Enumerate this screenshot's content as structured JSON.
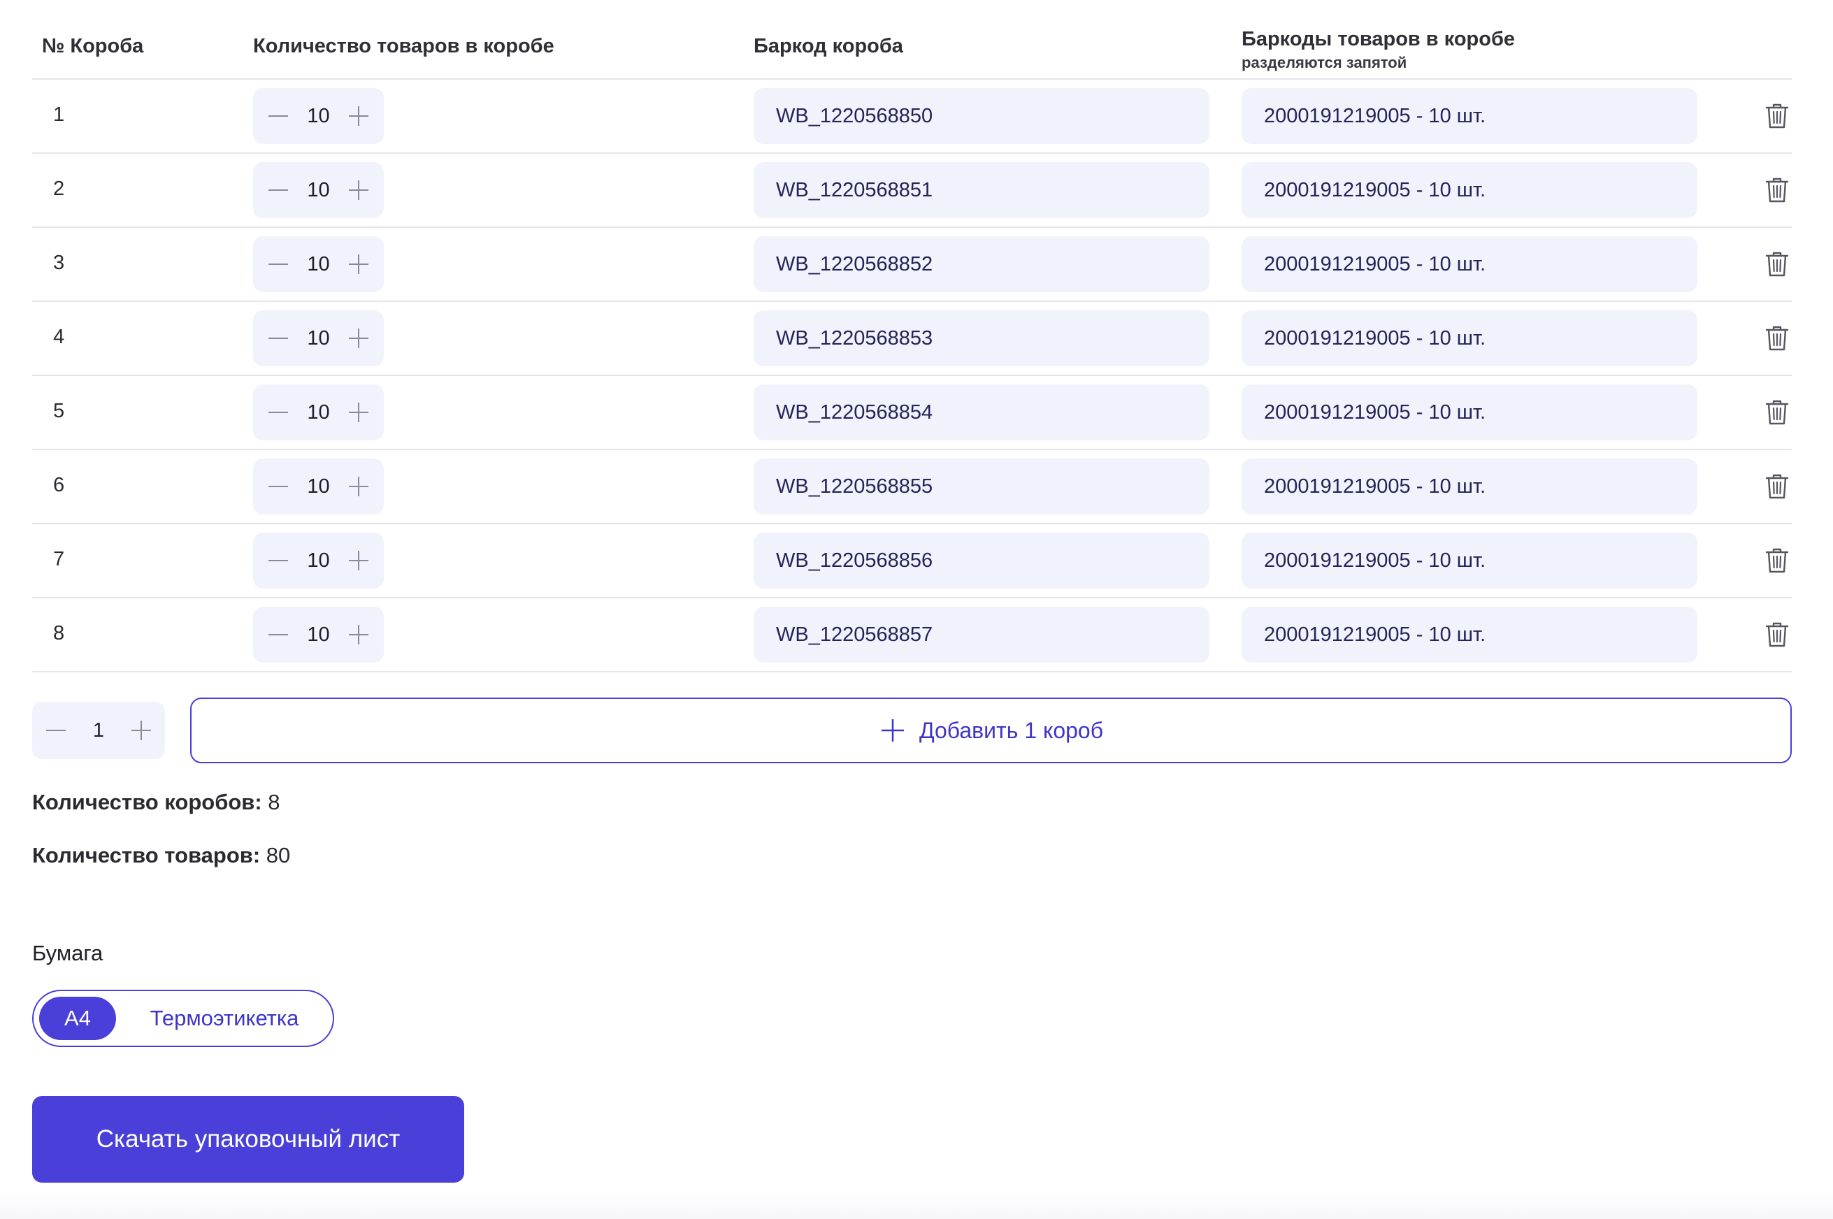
{
  "table": {
    "headers": {
      "box_no": "№ Короба",
      "qty": "Количество товаров в коробе",
      "box_barcode": "Баркод короба",
      "goods_barcodes": "Баркоды товаров в коробе",
      "goods_barcodes_hint": "разделяются запятой"
    },
    "rows": [
      {
        "num": "1",
        "qty": "10",
        "box_barcode": "WB_1220568850",
        "goods": "2000191219005 - 10 шт."
      },
      {
        "num": "2",
        "qty": "10",
        "box_barcode": "WB_1220568851",
        "goods": "2000191219005 - 10 шт."
      },
      {
        "num": "3",
        "qty": "10",
        "box_barcode": "WB_1220568852",
        "goods": "2000191219005 - 10 шт."
      },
      {
        "num": "4",
        "qty": "10",
        "box_barcode": "WB_1220568853",
        "goods": "2000191219005 - 10 шт."
      },
      {
        "num": "5",
        "qty": "10",
        "box_barcode": "WB_1220568854",
        "goods": "2000191219005 - 10 шт."
      },
      {
        "num": "6",
        "qty": "10",
        "box_barcode": "WB_1220568855",
        "goods": "2000191219005 - 10 шт."
      },
      {
        "num": "7",
        "qty": "10",
        "box_barcode": "WB_1220568856",
        "goods": "2000191219005 - 10 шт."
      },
      {
        "num": "8",
        "qty": "10",
        "box_barcode": "WB_1220568857",
        "goods": "2000191219005 - 10 шт."
      }
    ],
    "row_icons": {
      "minus": "minus-icon",
      "plus": "plus-icon",
      "delete": "trash-icon"
    }
  },
  "add": {
    "count": "1",
    "label": "Добавить 1 короб",
    "icon": "plus-icon"
  },
  "summary": {
    "boxes_label": "Количество коробов:",
    "boxes_value": "8",
    "goods_label": "Количество товаров:",
    "goods_value": "80"
  },
  "paper": {
    "label": "Бумага",
    "options": [
      "А4",
      "Термоэтикетка"
    ],
    "selected": "А4"
  },
  "download": {
    "label": "Скачать упаковочный лист"
  },
  "colors": {
    "accent": "#4a3fd9",
    "field_bg": "#f0f3fb",
    "divider": "#e4e4ea",
    "text_dark": "#1f1f26"
  }
}
